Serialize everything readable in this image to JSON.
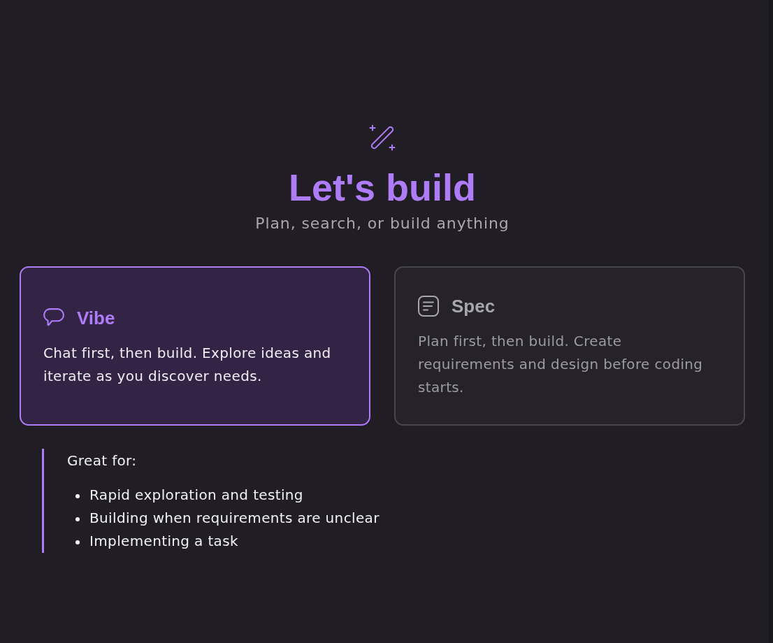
{
  "header": {
    "title": "Let's build",
    "subtitle": "Plan, search, or build anything"
  },
  "modes": [
    {
      "kind": "chat",
      "title": "Vibe",
      "description": "Chat first, then build. Explore ideas and iterate as you discover needs.",
      "selected": true
    },
    {
      "kind": "spec",
      "title": "Spec",
      "description": "Plan first, then build. Create requirements and design before coding starts.",
      "selected": false
    }
  ],
  "great_for": {
    "heading": "Great for:",
    "items": [
      "Rapid exploration and testing",
      "Building when requirements are unclear",
      "Implementing a task"
    ]
  }
}
